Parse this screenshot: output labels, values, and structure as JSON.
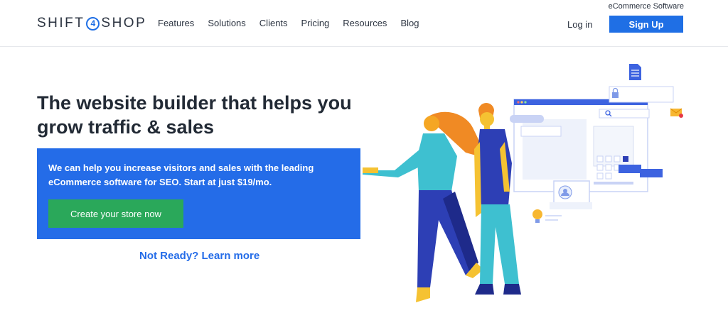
{
  "header": {
    "logo_left": "SHIFT",
    "logo_mid": "4",
    "logo_right": "SHOP",
    "tagline": "eCommerce Software",
    "nav": [
      "Features",
      "Solutions",
      "Clients",
      "Pricing",
      "Resources",
      "Blog"
    ],
    "login": "Log in",
    "signup": "Sign Up"
  },
  "hero": {
    "headline": "The website builder that helps you grow traffic & sales",
    "description": "We can help you increase visitors and sales with the leading eCommerce software for SEO. Start at just $19/mo.",
    "cta": "Create your store now",
    "learn_more": "Not Ready? Learn more"
  },
  "colors": {
    "primary": "#246ce8",
    "cta": "#2aa85a",
    "hair": "#f08a24",
    "shirt_woman": "#3ec0d0",
    "shirt_man": "#2d3fb5"
  },
  "icons": [
    "document-icon",
    "lock-icon",
    "search-icon",
    "mail-icon",
    "lightbulb-icon",
    "user-avatar-icon"
  ]
}
